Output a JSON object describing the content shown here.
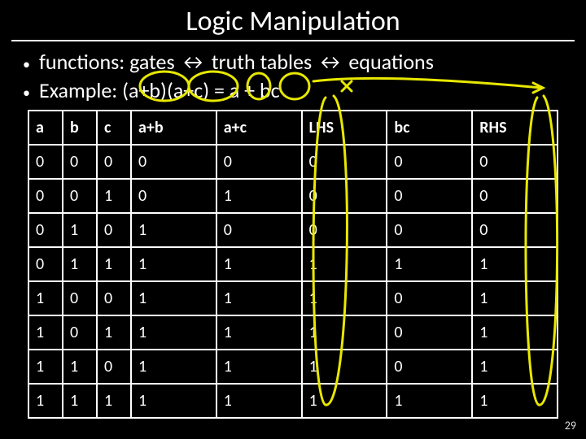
{
  "title": "Logic Manipulation",
  "bullets": [
    "functions: gates ↔ truth tables ↔ equations",
    "Example: (a+b)(a+c) = a + bc"
  ],
  "table": {
    "headers": [
      "a",
      "b",
      "c",
      "a+b",
      "a+c",
      "LHS",
      "bc",
      "RHS"
    ],
    "rows": [
      [
        "0",
        "0",
        "0",
        "0",
        "0",
        "0",
        "0",
        "0"
      ],
      [
        "0",
        "0",
        "1",
        "0",
        "1",
        "0",
        "0",
        "0"
      ],
      [
        "0",
        "1",
        "0",
        "1",
        "0",
        "0",
        "0",
        "0"
      ],
      [
        "0",
        "1",
        "1",
        "1",
        "1",
        "1",
        "1",
        "1"
      ],
      [
        "1",
        "0",
        "0",
        "1",
        "1",
        "1",
        "0",
        "1"
      ],
      [
        "1",
        "0",
        "1",
        "1",
        "1",
        "1",
        "0",
        "1"
      ],
      [
        "1",
        "1",
        "0",
        "1",
        "1",
        "1",
        "0",
        "1"
      ],
      [
        "1",
        "1",
        "1",
        "1",
        "1",
        "1",
        "1",
        "1"
      ]
    ]
  },
  "page_number": "29",
  "chart_data": {
    "type": "table",
    "title": "Truth table for (a+b)(a+c) = a + bc",
    "columns": [
      "a",
      "b",
      "c",
      "a+b",
      "a+c",
      "LHS",
      "bc",
      "RHS"
    ],
    "rows": [
      [
        0,
        0,
        0,
        0,
        0,
        0,
        0,
        0
      ],
      [
        0,
        0,
        1,
        0,
        1,
        0,
        0,
        0
      ],
      [
        0,
        1,
        0,
        1,
        0,
        0,
        0,
        0
      ],
      [
        0,
        1,
        1,
        1,
        1,
        1,
        1,
        1
      ],
      [
        1,
        0,
        0,
        1,
        1,
        1,
        0,
        1
      ],
      [
        1,
        0,
        1,
        1,
        1,
        1,
        0,
        1
      ],
      [
        1,
        1,
        0,
        1,
        1,
        1,
        0,
        1
      ],
      [
        1,
        1,
        1,
        1,
        1,
        1,
        1,
        1
      ]
    ]
  }
}
